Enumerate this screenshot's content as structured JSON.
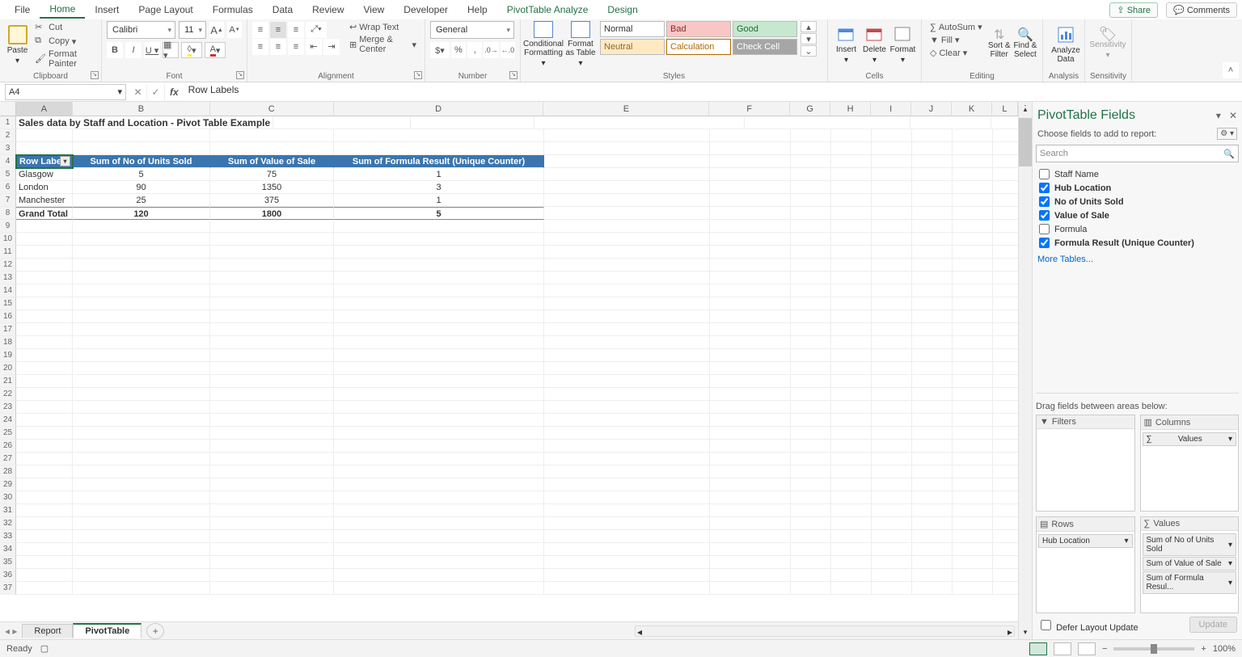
{
  "tabs": [
    "File",
    "Home",
    "Insert",
    "Page Layout",
    "Formulas",
    "Data",
    "Review",
    "View",
    "Developer",
    "Help",
    "PivotTable Analyze",
    "Design"
  ],
  "share": "Share",
  "comments": "Comments",
  "clipboard": {
    "paste": "Paste",
    "cut": "Cut",
    "copy": "Copy",
    "painter": "Format Painter",
    "label": "Clipboard"
  },
  "font": {
    "name": "Calibri",
    "size": "11",
    "label": "Font"
  },
  "alignment": {
    "wrap": "Wrap Text",
    "merge": "Merge & Center",
    "label": "Alignment"
  },
  "number": {
    "format": "General",
    "label": "Number"
  },
  "styles": {
    "cond": "Conditional Formatting",
    "fat": "Format as Table",
    "normal": "Normal",
    "bad": "Bad",
    "good": "Good",
    "neutral": "Neutral",
    "calc": "Calculation",
    "check": "Check Cell",
    "label": "Styles"
  },
  "cells": {
    "insert": "Insert",
    "delete": "Delete",
    "format": "Format",
    "label": "Cells"
  },
  "editing": {
    "autosum": "AutoSum",
    "fill": "Fill",
    "clear": "Clear",
    "sort": "Sort & Filter",
    "find": "Find & Select",
    "label": "Editing"
  },
  "analysis": {
    "analyze": "Analyze Data",
    "label": "Analysis"
  },
  "sensitivity": {
    "btn": "Sensitivity",
    "label": "Sensitivity"
  },
  "namebox": "A4",
  "formula": "Row Labels",
  "cols": [
    "A",
    "B",
    "C",
    "D",
    "E",
    "F",
    "G",
    "H",
    "I",
    "J",
    "K",
    "L"
  ],
  "title_cell": "Sales data by Staff and Location - Pivot Table Example",
  "pivot": {
    "headers": [
      "Row Labels",
      "Sum of No of Units Sold",
      "Sum of Value of Sale",
      "Sum of Formula Result (Unique Counter)"
    ],
    "rows": [
      {
        "label": "Glasgow",
        "v": [
          "5",
          "75",
          "1"
        ]
      },
      {
        "label": "London",
        "v": [
          "90",
          "1350",
          "3"
        ]
      },
      {
        "label": "Manchester",
        "v": [
          "25",
          "375",
          "1"
        ]
      }
    ],
    "total": {
      "label": "Grand Total",
      "v": [
        "120",
        "1800",
        "5"
      ]
    }
  },
  "pane": {
    "title": "PivotTable Fields",
    "choose": "Choose fields to add to report:",
    "search": "Search",
    "fields": [
      {
        "label": "Staff Name",
        "checked": false
      },
      {
        "label": "Hub Location",
        "checked": true
      },
      {
        "label": "No of Units Sold",
        "checked": true
      },
      {
        "label": "Value of Sale",
        "checked": true
      },
      {
        "label": "Formula",
        "checked": false
      },
      {
        "label": "Formula Result (Unique Counter)",
        "checked": true
      }
    ],
    "more": "More Tables...",
    "drag": "Drag fields between areas below:",
    "filters": "Filters",
    "columns": "Columns",
    "rows": "Rows",
    "values": "Values",
    "col_items": [
      "Values"
    ],
    "row_items": [
      "Hub Location"
    ],
    "val_items": [
      "Sum of No of Units Sold",
      "Sum of Value of Sale",
      "Sum of Formula Resul..."
    ],
    "defer": "Defer Layout Update",
    "update": "Update"
  },
  "sheets": {
    "list": [
      "Report",
      "PivotTable"
    ],
    "active": 1
  },
  "status": {
    "ready": "Ready",
    "zoom": "100%"
  }
}
